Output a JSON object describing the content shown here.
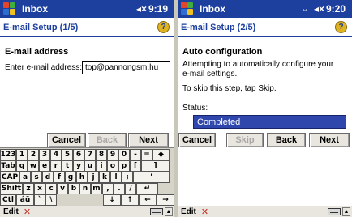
{
  "left_screen": {
    "titlebar": {
      "app_title": "Inbox",
      "speaker_icon": "speaker-icon",
      "time": "9:19"
    },
    "header": {
      "page_title": "E-mail Setup (1/5)",
      "help_icon": "help-icon"
    },
    "section_heading": "E-mail address",
    "email_label": "Enter e-mail address:",
    "email_value": "top@pannongsm.hu",
    "buttons": {
      "cancel": "Cancel",
      "back": "Back",
      "next": "Next"
    },
    "keyboard": {
      "rows": [
        [
          "123",
          "1",
          "2",
          "3",
          "4",
          "5",
          "6",
          "7",
          "8",
          "9",
          "0",
          "-",
          "=",
          "◆"
        ],
        [
          "Tab",
          "q",
          "w",
          "e",
          "r",
          "t",
          "y",
          "u",
          "i",
          "o",
          "p",
          "[",
          "]"
        ],
        [
          "CAP",
          "a",
          "s",
          "d",
          "f",
          "g",
          "h",
          "j",
          "k",
          "l",
          ";",
          "'"
        ],
        [
          "Shift",
          "z",
          "x",
          "c",
          "v",
          "b",
          "n",
          "m",
          ",",
          ".",
          "/",
          "↵"
        ],
        [
          "Ctl",
          "áü",
          "`",
          "\\",
          "↓",
          "↑",
          "←",
          "→"
        ]
      ]
    },
    "menubar": {
      "edit": "Edit",
      "close_glyph": "✕"
    }
  },
  "right_screen": {
    "titlebar": {
      "app_title": "Inbox",
      "connection_glyph": "↔",
      "time": "9:20"
    },
    "header": {
      "page_title": "E-mail Setup (2/5)",
      "help_icon": "help-icon"
    },
    "section_heading": "Auto configuration",
    "description_line1": "Attempting to automatically configure your",
    "description_line2": "e-mail settings.",
    "skip_hint": "To skip this step, tap Skip.",
    "status_label": "Status:",
    "status_value": "Completed",
    "buttons": {
      "cancel": "Cancel",
      "skip": "Skip",
      "back": "Back",
      "next": "Next"
    },
    "menubar": {
      "edit": "Edit",
      "close_glyph": "✕"
    }
  },
  "colors": {
    "titlebar": "#1d3f9e",
    "status_fill": "#2f47ad",
    "close_x": "#c8281e"
  }
}
